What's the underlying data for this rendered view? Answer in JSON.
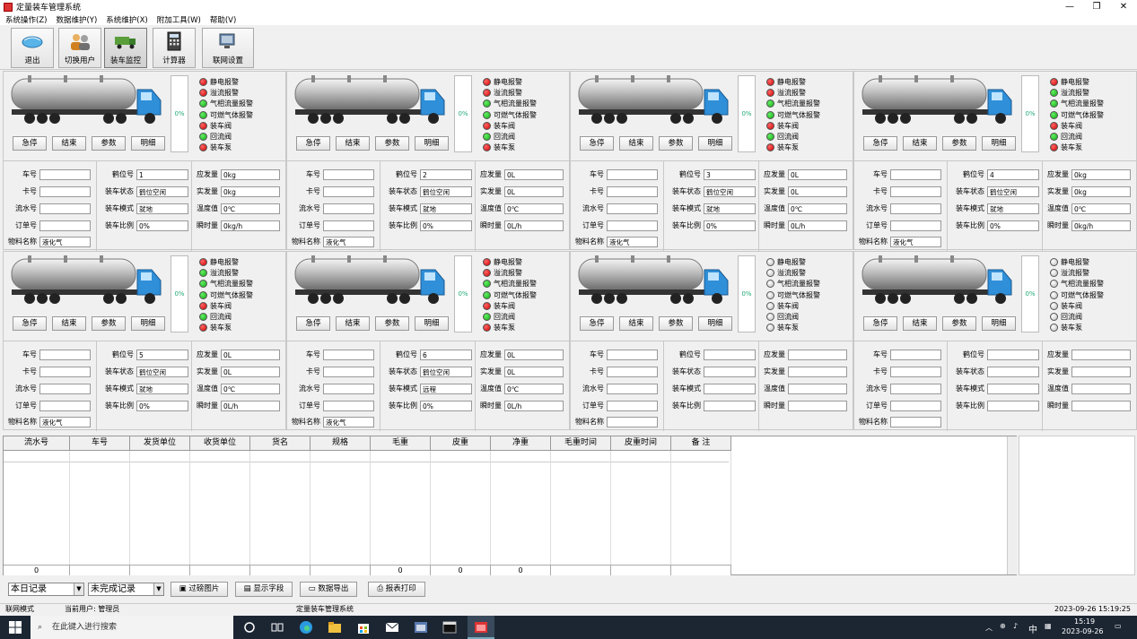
{
  "window": {
    "title": "定量装车管理系统"
  },
  "menu": [
    "系统操作(Z)",
    "数据维护(Y)",
    "系统维护(X)",
    "附加工具(W)",
    "帮助(V)"
  ],
  "toolbar": [
    "退出",
    "切换用户",
    "装车监控",
    "计算器",
    "联网设置"
  ],
  "panel_buttons": [
    "急停",
    "结束",
    "参数",
    "明细"
  ],
  "alarm_labels": [
    "静电报警",
    "溢流报警",
    "气相流量报警",
    "可燃气体报警",
    "装车阀",
    "回流阀",
    "装车泵"
  ],
  "field_labels": {
    "che_hao": "车号",
    "ka_hao": "卡号",
    "liu_shui": "流水号",
    "ding_dan": "订单号",
    "wu_liao": "物料名称",
    "he_wei": "鹤位号",
    "zhuang_che_zhuang_tai": "装车状态",
    "zhuang_che_mo_shi": "装车模式",
    "zhuang_che_bi_li": "装车比例",
    "ying_fa": "应发量",
    "shi_fa": "实发量",
    "wen_du": "温度值",
    "shun_shi": "瞬时量"
  },
  "colors": {
    "alarm_red": "#cc0000",
    "alarm_green": "#11aa11",
    "alarm_off": "#bbbbbb",
    "truck_cab": "#2f8fd8"
  },
  "panels": [
    {
      "gauge": "0%",
      "alarms": [
        "red",
        "red",
        "green",
        "green",
        "red",
        "green",
        "red"
      ],
      "vals": {
        "che_hao": "",
        "ka_hao": "",
        "liu_shui": "",
        "ding_dan": "",
        "wu_liao": "液化气",
        "he_wei": "1",
        "zhuang_che_zhuang_tai": "鹤位空闲",
        "zhuang_che_mo_shi": "就地",
        "zhuang_che_bi_li": "0%",
        "ying_fa": "0kg",
        "shi_fa": "0kg",
        "wen_du": "0℃",
        "shun_shi": "0kg/h"
      }
    },
    {
      "gauge": "0%",
      "alarms": [
        "red",
        "red",
        "green",
        "green",
        "red",
        "green",
        "red"
      ],
      "vals": {
        "che_hao": "",
        "ka_hao": "",
        "liu_shui": "",
        "ding_dan": "",
        "wu_liao": "液化气",
        "he_wei": "2",
        "zhuang_che_zhuang_tai": "鹤位空闲",
        "zhuang_che_mo_shi": "就地",
        "zhuang_che_bi_li": "0%",
        "ying_fa": "0L",
        "shi_fa": "0L",
        "wen_du": "0℃",
        "shun_shi": "0L/h"
      }
    },
    {
      "gauge": "0%",
      "alarms": [
        "red",
        "red",
        "green",
        "green",
        "red",
        "green",
        "red"
      ],
      "vals": {
        "che_hao": "",
        "ka_hao": "",
        "liu_shui": "",
        "ding_dan": "",
        "wu_liao": "液化气",
        "he_wei": "3",
        "zhuang_che_zhuang_tai": "鹤位空闲",
        "zhuang_che_mo_shi": "就地",
        "zhuang_che_bi_li": "0%",
        "ying_fa": "0L",
        "shi_fa": "0L",
        "wen_du": "0℃",
        "shun_shi": "0L/h"
      }
    },
    {
      "gauge": "0%",
      "alarms": [
        "red",
        "green",
        "green",
        "green",
        "red",
        "green",
        "red"
      ],
      "vals": {
        "che_hao": "",
        "ka_hao": "",
        "liu_shui": "",
        "ding_dan": "",
        "wu_liao": "液化气",
        "he_wei": "4",
        "zhuang_che_zhuang_tai": "鹤位空闲",
        "zhuang_che_mo_shi": "就地",
        "zhuang_che_bi_li": "0%",
        "ying_fa": "0kg",
        "shi_fa": "0kg",
        "wen_du": "0℃",
        "shun_shi": "0kg/h"
      }
    },
    {
      "gauge": "0%",
      "alarms": [
        "red",
        "green",
        "green",
        "green",
        "red",
        "green",
        "red"
      ],
      "vals": {
        "che_hao": "",
        "ka_hao": "",
        "liu_shui": "",
        "ding_dan": "",
        "wu_liao": "液化气",
        "he_wei": "5",
        "zhuang_che_zhuang_tai": "鹤位空闲",
        "zhuang_che_mo_shi": "就地",
        "zhuang_che_bi_li": "0%",
        "ying_fa": "0L",
        "shi_fa": "0L",
        "wen_du": "0℃",
        "shun_shi": "0L/h"
      }
    },
    {
      "gauge": "0%",
      "alarms": [
        "red",
        "red",
        "green",
        "green",
        "red",
        "green",
        "red"
      ],
      "vals": {
        "che_hao": "",
        "ka_hao": "",
        "liu_shui": "",
        "ding_dan": "",
        "wu_liao": "液化气",
        "he_wei": "6",
        "zhuang_che_zhuang_tai": "鹤位空闲",
        "zhuang_che_mo_shi": "远程",
        "zhuang_che_bi_li": "0%",
        "ying_fa": "0L",
        "shi_fa": "0L",
        "wen_du": "0℃",
        "shun_shi": "0L/h"
      }
    },
    {
      "gauge": "0%",
      "alarms": [
        "gray",
        "gray",
        "gray",
        "gray",
        "gray",
        "gray",
        "gray"
      ],
      "vals": {
        "che_hao": "",
        "ka_hao": "",
        "liu_shui": "",
        "ding_dan": "",
        "wu_liao": "",
        "he_wei": "",
        "zhuang_che_zhuang_tai": "",
        "zhuang_che_mo_shi": "",
        "zhuang_che_bi_li": "",
        "ying_fa": "",
        "shi_fa": "",
        "wen_du": "",
        "shun_shi": ""
      }
    },
    {
      "gauge": "0%",
      "alarms": [
        "gray",
        "gray",
        "gray",
        "gray",
        "gray",
        "gray",
        "gray"
      ],
      "vals": {
        "che_hao": "",
        "ka_hao": "",
        "liu_shui": "",
        "ding_dan": "",
        "wu_liao": "",
        "he_wei": "",
        "zhuang_che_zhuang_tai": "",
        "zhuang_che_mo_shi": "",
        "zhuang_che_bi_li": "",
        "ying_fa": "",
        "shi_fa": "",
        "wen_du": "",
        "shun_shi": ""
      }
    }
  ],
  "table": {
    "columns": [
      "流水号",
      "车号",
      "发货单位",
      "收货单位",
      "货名",
      "规格",
      "毛重",
      "皮重",
      "净重",
      "毛重时间",
      "皮重时间",
      "备  注"
    ],
    "footer": [
      "0",
      "",
      "",
      "",
      "",
      "",
      "0",
      "0",
      "0",
      "",
      "",
      ""
    ]
  },
  "bottom": {
    "select1": "本日记录",
    "select2": "未完成记录",
    "buttons": [
      "过磅图片",
      "显示字段",
      "数据导出",
      "报表打印"
    ]
  },
  "status": {
    "mode": "联网模式",
    "user": "当前用户: 管理员",
    "app": "定量装车管理系统",
    "datetime": "2023-09-26 15:19:25"
  },
  "taskbar": {
    "search_placeholder": "在此键入进行搜索",
    "time": "15:19",
    "date": "2023-09-26",
    "ime": "中"
  }
}
